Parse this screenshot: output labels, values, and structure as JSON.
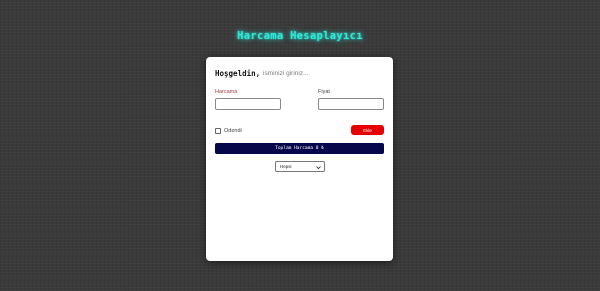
{
  "title": "Harcama Hesaplayıcı",
  "card": {
    "welcome": "Hoşgeldin,",
    "name_placeholder": "isminizi giriniz...",
    "expense_label": "Harcama",
    "price_label": "Fiyat",
    "paid_label": "Odendi",
    "add_button": "Ekle",
    "total_text": "Toplam Harcama 0 ₺",
    "filter_selected": "Hepsi"
  },
  "colors": {
    "title_glow": "#2fe8d8",
    "add_button": "#e60000",
    "total_bar": "#06064a",
    "background": "#3a3a3a"
  }
}
